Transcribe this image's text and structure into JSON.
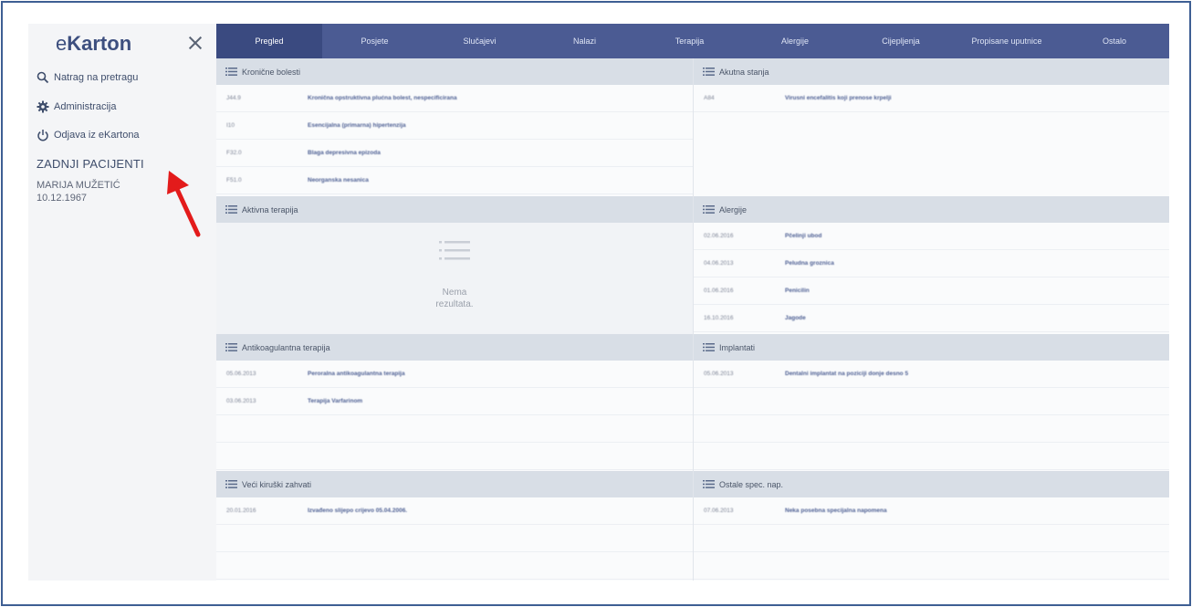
{
  "app": {
    "logo_prefix": "e",
    "logo_main": "Karton",
    "close_icon": "close-icon"
  },
  "sidebar": {
    "back_search": "Natrag na pretragu",
    "administration": "Administracija",
    "logout": "Odjava iz eKartona",
    "recent_title": "ZADNJI PACIJENTI",
    "patient_name": "MARIJA MUŽETIĆ",
    "patient_dob": "10.12.1967"
  },
  "tabs": [
    {
      "label": "Pregled"
    },
    {
      "label": "Posjete"
    },
    {
      "label": "Slučajevi"
    },
    {
      "label": "Nalazi"
    },
    {
      "label": "Terapija"
    },
    {
      "label": "Alergije"
    },
    {
      "label": "Cijepljenja"
    },
    {
      "label": "Propisane uputnice"
    },
    {
      "label": "Ostalo"
    }
  ],
  "panels": {
    "chronic": {
      "title": "Kronične bolesti",
      "rows": [
        {
          "c1": "J44.9",
          "c2": "Kronična opstruktivna plućna bolest, nespecificirana"
        },
        {
          "c1": "I10",
          "c2": "Esencijalna (primarna) hipertenzija"
        },
        {
          "c1": "F32.0",
          "c2": "Blaga depresivna epizoda"
        },
        {
          "c1": "F51.0",
          "c2": "Neorganska nesanica"
        }
      ]
    },
    "acute": {
      "title": "Akutna stanja",
      "rows": [
        {
          "c1": "A84",
          "c2": "Virusni encefalitis koji prenose krpelji"
        }
      ]
    },
    "active_therapy": {
      "title": "Aktivna terapija",
      "empty_line1": "Nema",
      "empty_line2": "rezultata."
    },
    "allergies": {
      "title": "Alergije",
      "rows": [
        {
          "c1": "02.06.2016",
          "c2": "Pčelinji ubod"
        },
        {
          "c1": "04.06.2013",
          "c2": "Peludna groznica"
        },
        {
          "c1": "01.06.2016",
          "c2": "Penicilin"
        },
        {
          "c1": "16.10.2016",
          "c2": "Jagode"
        }
      ]
    },
    "anticoag": {
      "title": "Antikoagulantna terapija",
      "rows": [
        {
          "c1": "05.06.2013",
          "c2": "Peroralna antikoagulantna terapija"
        },
        {
          "c1": "03.06.2013",
          "c2": "Terapija Varfarinom"
        }
      ]
    },
    "implants": {
      "title": "Implantati",
      "rows": [
        {
          "c1": "05.06.2013",
          "c2": "Dentalni implantat na poziciji donje desno 5"
        }
      ]
    },
    "surgery": {
      "title": "Veći kiruški zahvati",
      "rows": [
        {
          "c1": "20.01.2016",
          "c2": "Izvađeno slijepo crijevo 05.04.2006."
        }
      ]
    },
    "other_notes": {
      "title": "Ostale spec. nap.",
      "rows": [
        {
          "c1": "07.06.2013",
          "c2": "Neka posebna specijalna napomena"
        }
      ]
    }
  },
  "colors": {
    "tab_bar": "#4b5b93",
    "tab_active": "#3a4a80",
    "panel_head": "#d8dee6",
    "annotation_arrow": "#e31b1b"
  }
}
